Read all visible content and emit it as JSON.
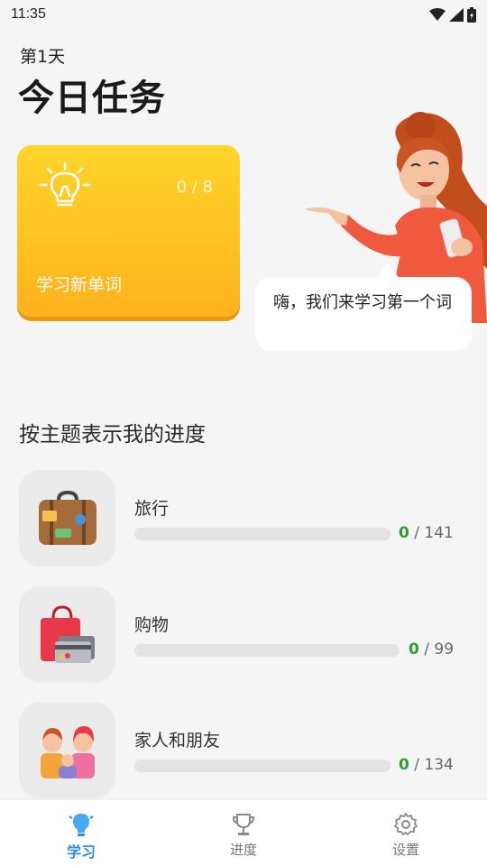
{
  "status_bar": {
    "time": "11:35"
  },
  "header": {
    "day": "第1天",
    "title": "今日任务"
  },
  "task_card": {
    "progress": "0 / 8",
    "label": "学习新单词"
  },
  "speech_bubble": {
    "text": "嗨，我们来学习第一个词"
  },
  "section": {
    "title": "按主题表示我的进度"
  },
  "topics": [
    {
      "name": "旅行",
      "done": "0",
      "total": "/ 141",
      "progress": 0,
      "icon": "suitcase-icon"
    },
    {
      "name": "购物",
      "done": "0",
      "total": "/ 99",
      "progress": 0,
      "icon": "shopping-bag-icon"
    },
    {
      "name": "家人和朋友",
      "done": "0",
      "total": "/ 134",
      "progress": 0,
      "icon": "family-icon"
    }
  ],
  "bottom_nav": {
    "items": [
      {
        "label": "学习",
        "icon": "lightbulb-icon",
        "active": true
      },
      {
        "label": "进度",
        "icon": "trophy-icon",
        "active": false
      },
      {
        "label": "设置",
        "icon": "gear-icon",
        "active": false
      }
    ]
  },
  "colors": {
    "accent": "#2a8ee8",
    "card": "#ffc21f",
    "done": "#2e9e2e"
  }
}
